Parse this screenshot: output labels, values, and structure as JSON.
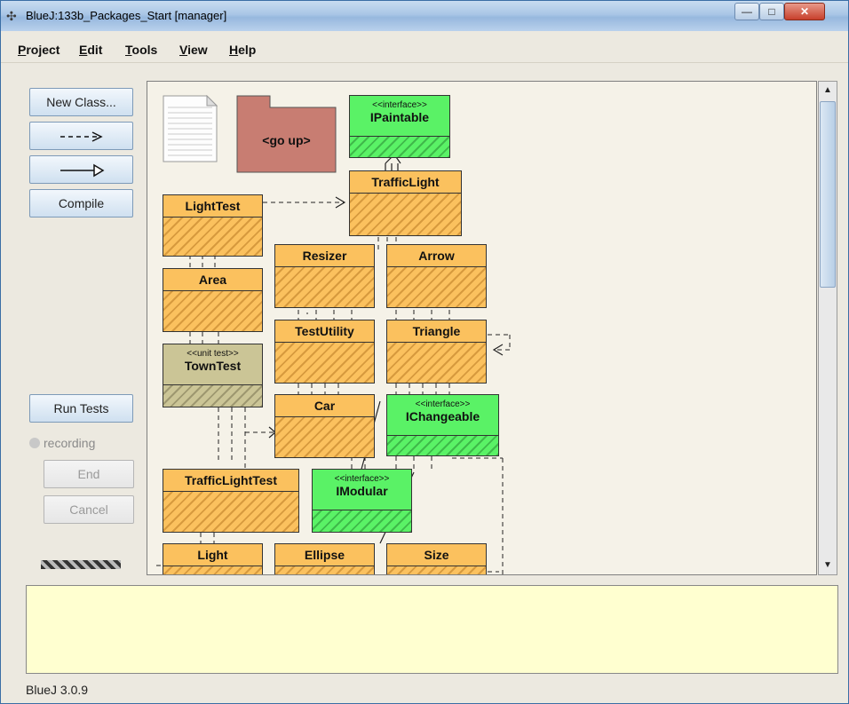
{
  "window": {
    "title": "BlueJ:133b_Packages_Start  [manager]"
  },
  "menu": [
    {
      "m": "P",
      "rest": "roject"
    },
    {
      "m": "E",
      "rest": "dit"
    },
    {
      "m": "T",
      "rest": "ools"
    },
    {
      "m": "V",
      "rest": "iew"
    },
    {
      "m": "H",
      "rest": "elp"
    }
  ],
  "toolbar": {
    "new_class": "New Class...",
    "dep_arrow": "- - ->",
    "inherit_arrow": "——▷",
    "compile": "Compile",
    "run_tests": "Run Tests",
    "recording": "recording",
    "end": "End",
    "cancel": "Cancel"
  },
  "diagram": {
    "go_up": "<go up>",
    "classes": {
      "ipaintable": {
        "stereo": "<<interface>>",
        "name": "IPaintable"
      },
      "trafficlight": {
        "name": "TrafficLight"
      },
      "lighttest": {
        "name": "LightTest"
      },
      "resizer": {
        "name": "Resizer"
      },
      "arrow": {
        "name": "Arrow"
      },
      "area": {
        "name": "Area"
      },
      "testutility": {
        "name": "TestUtility"
      },
      "triangle": {
        "name": "Triangle"
      },
      "towntest": {
        "stereo": "<<unit test>>",
        "name": "TownTest"
      },
      "car": {
        "name": "Car"
      },
      "ichangeable": {
        "stereo": "<<interface>>",
        "name": "IChangeable"
      },
      "trafficlighttest": {
        "name": "TrafficLightTest"
      },
      "imodular": {
        "stereo": "<<interface>>",
        "name": "IModular"
      },
      "light": {
        "name": "Light"
      },
      "ellipse": {
        "name": "Ellipse"
      },
      "size": {
        "name": "Size"
      }
    }
  },
  "status": "BlueJ 3.0.9",
  "colors": {
    "class": "#fbc15e",
    "interface": "#5af266",
    "unit_test": "#cbc596",
    "folder": "#c87d72"
  }
}
